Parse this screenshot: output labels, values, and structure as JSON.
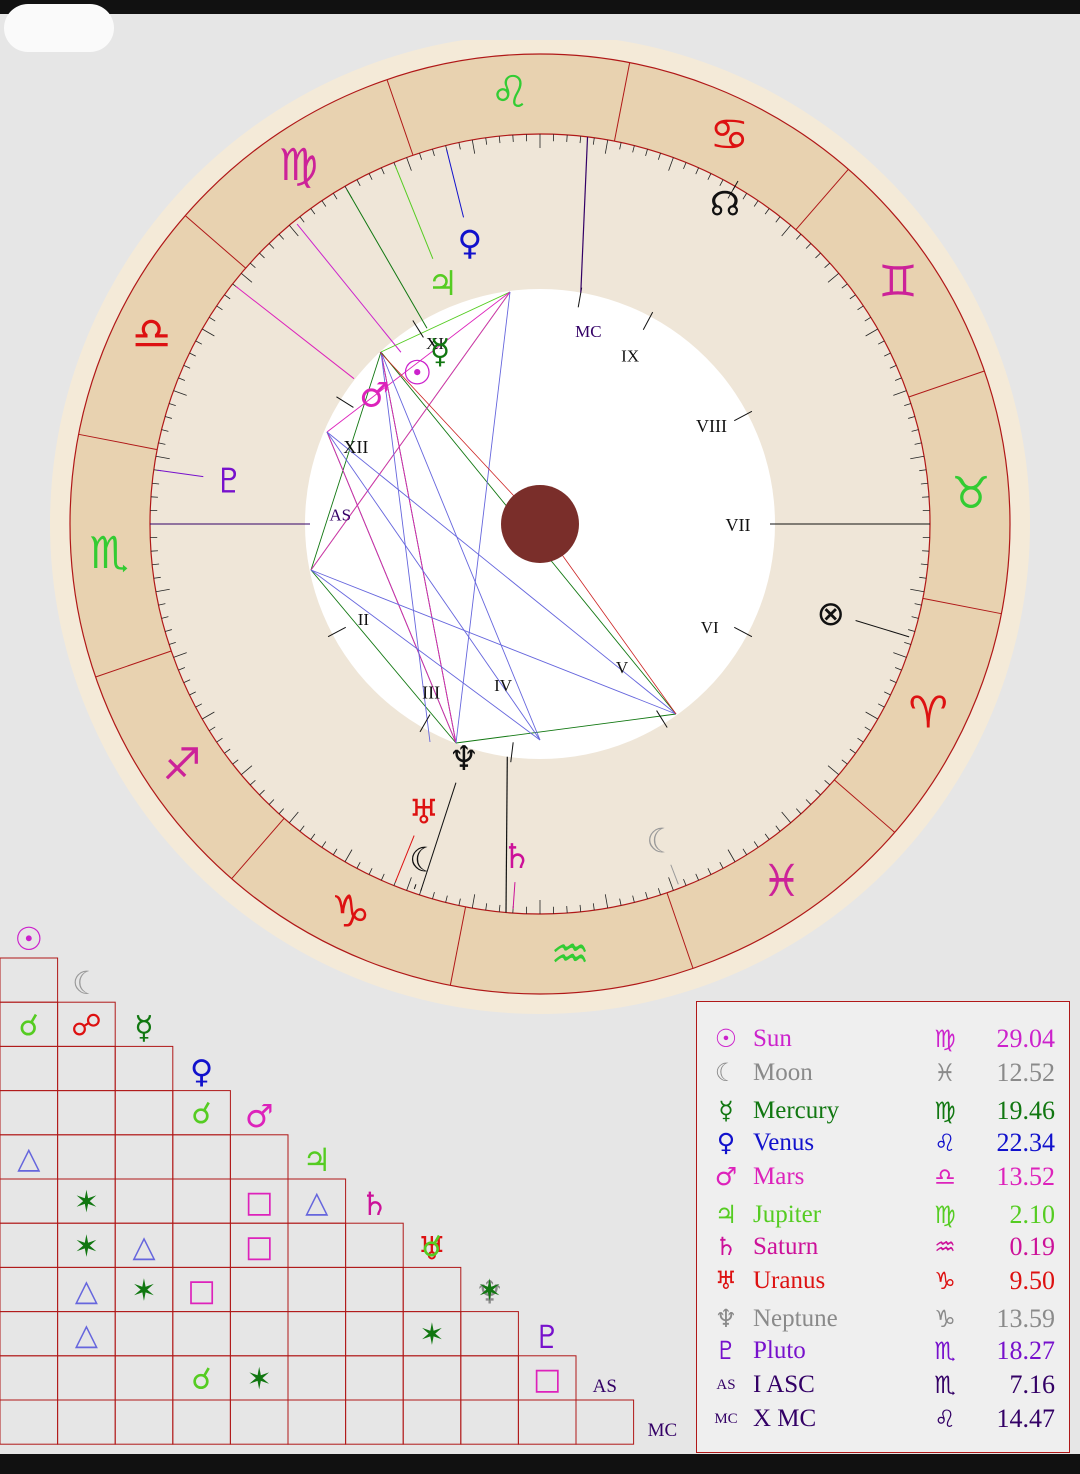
{
  "colors": {
    "sun": "#cc22cc",
    "moon": "#9a9a9a",
    "mercury": "#117711",
    "venus": "#1111cc",
    "mars": "#dd22bb",
    "jupiter": "#55cc22",
    "saturn": "#cc1199",
    "uranus": "#dd1111",
    "neptune": "#8a8a8a",
    "pluto": "#7711cc",
    "angle": "#330066",
    "grid_line": "#b01818",
    "band": "#e8d2b0",
    "outer_ring": "#f4ead8",
    "inner_disc": "#efe6d8"
  },
  "wheel": {
    "signs": [
      {
        "icon": "leo-icon",
        "glyph": "♌",
        "color": "#33cc33"
      },
      {
        "icon": "cancer-icon",
        "glyph": "♋",
        "color": "#dd1111"
      },
      {
        "icon": "gemini-icon",
        "glyph": "♊",
        "color": "#cc2299"
      },
      {
        "icon": "taurus-icon",
        "glyph": "♉",
        "color": "#33cc33"
      },
      {
        "icon": "aries-icon",
        "glyph": "♈",
        "color": "#dd1111"
      },
      {
        "icon": "pisces-icon",
        "glyph": "♓",
        "color": "#cc2299"
      },
      {
        "icon": "aquarius-icon",
        "glyph": "♒",
        "color": "#33cc33"
      },
      {
        "icon": "capricorn-icon",
        "glyph": "♑",
        "color": "#dd1111"
      },
      {
        "icon": "sagittarius-icon",
        "glyph": "♐",
        "color": "#cc2299"
      },
      {
        "icon": "scorpio-icon",
        "glyph": "♏",
        "color": "#33cc33"
      },
      {
        "icon": "libra-icon",
        "glyph": "♎",
        "color": "#dd1111"
      },
      {
        "icon": "virgo-icon",
        "glyph": "♍",
        "color": "#cc2299"
      }
    ],
    "houses": [
      "XI",
      "XII",
      "AS",
      "II",
      "III",
      "IV",
      "V",
      "VI",
      "VII",
      "VIII",
      "IX",
      "MC"
    ],
    "planets": [
      {
        "icon": "venus-icon",
        "glyph": "♀",
        "color": "#1111cc"
      },
      {
        "icon": "jupiter-icon",
        "glyph": "♃",
        "color": "#55cc22"
      },
      {
        "icon": "mercury-icon",
        "glyph": "☿",
        "color": "#117711"
      },
      {
        "icon": "sun-icon",
        "glyph": "☉",
        "color": "#cc22cc"
      },
      {
        "icon": "mars-icon",
        "glyph": "♂",
        "color": "#dd22bb"
      },
      {
        "icon": "pluto-icon",
        "glyph": "♇",
        "color": "#7711cc"
      },
      {
        "icon": "neptune-icon",
        "glyph": "♆",
        "color": "#111111"
      },
      {
        "icon": "uranus-icon",
        "glyph": "♅",
        "color": "#dd1111"
      },
      {
        "icon": "moon-node-icon",
        "glyph": "☾",
        "color": "#111111"
      },
      {
        "icon": "saturn-icon",
        "glyph": "♄",
        "color": "#cc1199"
      },
      {
        "icon": "moon-icon",
        "glyph": "☾",
        "color": "#9a9a9a"
      },
      {
        "icon": "part-of-fortune-icon",
        "glyph": "⊗",
        "color": "#111111"
      },
      {
        "icon": "node-icon",
        "glyph": "☊",
        "color": "#111111"
      }
    ]
  },
  "aspect_grid": {
    "headers": [
      {
        "glyph": "☉",
        "color": "#cc22cc"
      },
      {
        "glyph": "☾",
        "color": "#9a9a9a"
      },
      {
        "glyph": "☿",
        "color": "#117711"
      },
      {
        "glyph": "♀",
        "color": "#1111cc"
      },
      {
        "glyph": "♂",
        "color": "#dd22bb"
      },
      {
        "glyph": "♃",
        "color": "#55cc22"
      },
      {
        "glyph": "♄",
        "color": "#cc1199"
      },
      {
        "glyph": "♅",
        "color": "#dd1111"
      },
      {
        "glyph": "♆",
        "color": "#8a8a8a"
      },
      {
        "glyph": "♇",
        "color": "#7711cc"
      },
      {
        "glyph": "AS",
        "color": "#330066"
      },
      {
        "glyph": "MC",
        "color": "#330066"
      }
    ],
    "aspects": [
      {
        "row": 1,
        "col": 0,
        "glyph": "☌",
        "color": "#55cc22"
      },
      {
        "row": 1,
        "col": 1,
        "glyph": "☍",
        "color": "#dd1111"
      },
      {
        "row": 3,
        "col": 3,
        "glyph": "☌",
        "color": "#55cc22"
      },
      {
        "row": 4,
        "col": 0,
        "glyph": "△",
        "color": "#6666dd"
      },
      {
        "row": 5,
        "col": 1,
        "glyph": "✶",
        "color": "#117711"
      },
      {
        "row": 5,
        "col": 4,
        "glyph": "□",
        "color": "#dd22bb"
      },
      {
        "row": 5,
        "col": 5,
        "glyph": "△",
        "color": "#6666dd"
      },
      {
        "row": 6,
        "col": 1,
        "glyph": "✶",
        "color": "#117711"
      },
      {
        "row": 6,
        "col": 2,
        "glyph": "△",
        "color": "#6666dd"
      },
      {
        "row": 6,
        "col": 4,
        "glyph": "□",
        "color": "#dd22bb"
      },
      {
        "row": 6,
        "col": 7,
        "glyph": "☌",
        "color": "#55cc22"
      },
      {
        "row": 7,
        "col": 1,
        "glyph": "△",
        "color": "#6666dd"
      },
      {
        "row": 7,
        "col": 2,
        "glyph": "✶",
        "color": "#117711"
      },
      {
        "row": 7,
        "col": 3,
        "glyph": "□",
        "color": "#dd22bb"
      },
      {
        "row": 7,
        "col": 8,
        "glyph": "✶",
        "color": "#117711"
      },
      {
        "row": 8,
        "col": 1,
        "glyph": "△",
        "color": "#6666dd"
      },
      {
        "row": 8,
        "col": 7,
        "glyph": "✶",
        "color": "#117711"
      },
      {
        "row": 9,
        "col": 3,
        "glyph": "☌",
        "color": "#55cc22"
      },
      {
        "row": 9,
        "col": 4,
        "glyph": "✶",
        "color": "#117711"
      },
      {
        "row": 9,
        "col": 9,
        "glyph": "□",
        "color": "#dd22bb"
      }
    ]
  },
  "legend": {
    "rows": [
      {
        "symbol": "☉",
        "name": "Sun",
        "sign": "♍",
        "degree": "29.04",
        "color": "#cc22cc",
        "icon": "sun-icon",
        "sign_icon": "virgo-icon"
      },
      {
        "symbol": "☾",
        "name": "Moon",
        "sign": "♓",
        "degree": "12.52",
        "color": "#8a8a8a",
        "icon": "moon-icon",
        "sign_icon": "pisces-icon"
      },
      {
        "symbol": "☿",
        "name": "Mercury",
        "sign": "♍",
        "degree": "19.46",
        "color": "#117711",
        "icon": "mercury-icon",
        "sign_icon": "virgo-icon"
      },
      {
        "symbol": "♀",
        "name": "Venus",
        "sign": "♌",
        "degree": "22.34",
        "color": "#1111cc",
        "icon": "venus-icon",
        "sign_icon": "leo-icon"
      },
      {
        "symbol": "♂",
        "name": "Mars",
        "sign": "♎",
        "degree": "13.52",
        "color": "#dd22bb",
        "icon": "mars-icon",
        "sign_icon": "libra-icon"
      },
      {
        "symbol": "♃",
        "name": "Jupiter",
        "sign": "♍",
        "degree": "2.10",
        "color": "#55cc22",
        "icon": "jupiter-icon",
        "sign_icon": "virgo-icon"
      },
      {
        "symbol": "♄",
        "name": "Saturn",
        "sign": "♒",
        "degree": "0.19",
        "color": "#cc1199",
        "icon": "saturn-icon",
        "sign_icon": "aquarius-icon"
      },
      {
        "symbol": "♅",
        "name": "Uranus",
        "sign": "♑",
        "degree": "9.50",
        "color": "#dd1111",
        "icon": "uranus-icon",
        "sign_icon": "capricorn-icon"
      },
      {
        "symbol": "♆",
        "name": "Neptune",
        "sign": "♑",
        "degree": "13.59",
        "color": "#8a8a8a",
        "icon": "neptune-icon",
        "sign_icon": "capricorn-icon"
      },
      {
        "symbol": "♇",
        "name": "Pluto",
        "sign": "♏",
        "degree": "18.27",
        "color": "#7711cc",
        "icon": "pluto-icon",
        "sign_icon": "scorpio-icon"
      },
      {
        "symbol": "AS",
        "name": "I ASC",
        "sign": "♏",
        "degree": "7.16",
        "color": "#330066",
        "icon": "ascendant-label",
        "sign_icon": "scorpio-icon"
      },
      {
        "symbol": "MC",
        "name": "X MC",
        "sign": "♌",
        "degree": "14.47",
        "color": "#330066",
        "icon": "midheaven-label",
        "sign_icon": "leo-icon"
      }
    ]
  }
}
